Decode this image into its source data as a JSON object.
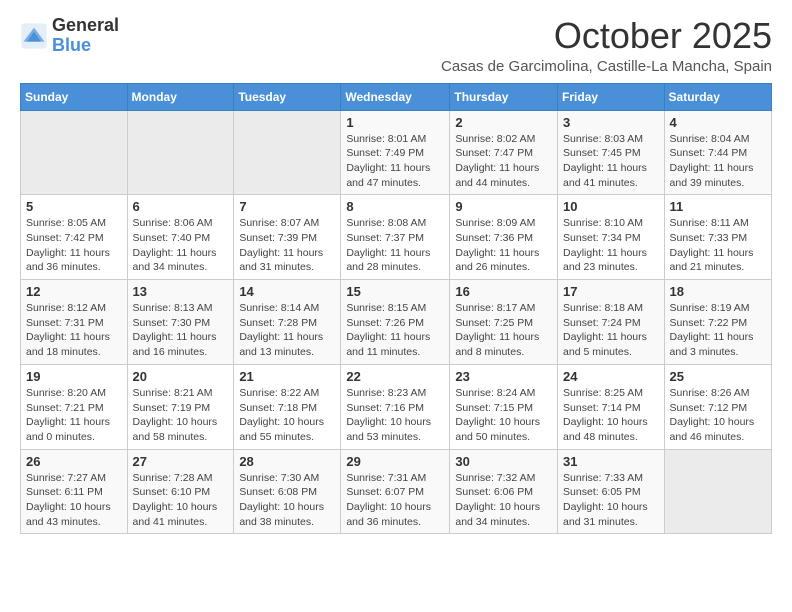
{
  "logo": {
    "general": "General",
    "blue": "Blue"
  },
  "header": {
    "month": "October 2025",
    "location": "Casas de Garcimolina, Castille-La Mancha, Spain"
  },
  "weekdays": [
    "Sunday",
    "Monday",
    "Tuesday",
    "Wednesday",
    "Thursday",
    "Friday",
    "Saturday"
  ],
  "weeks": [
    [
      {
        "day": "",
        "sunrise": "",
        "sunset": "",
        "daylight": ""
      },
      {
        "day": "",
        "sunrise": "",
        "sunset": "",
        "daylight": ""
      },
      {
        "day": "",
        "sunrise": "",
        "sunset": "",
        "daylight": ""
      },
      {
        "day": "1",
        "sunrise": "Sunrise: 8:01 AM",
        "sunset": "Sunset: 7:49 PM",
        "daylight": "Daylight: 11 hours and 47 minutes."
      },
      {
        "day": "2",
        "sunrise": "Sunrise: 8:02 AM",
        "sunset": "Sunset: 7:47 PM",
        "daylight": "Daylight: 11 hours and 44 minutes."
      },
      {
        "day": "3",
        "sunrise": "Sunrise: 8:03 AM",
        "sunset": "Sunset: 7:45 PM",
        "daylight": "Daylight: 11 hours and 41 minutes."
      },
      {
        "day": "4",
        "sunrise": "Sunrise: 8:04 AM",
        "sunset": "Sunset: 7:44 PM",
        "daylight": "Daylight: 11 hours and 39 minutes."
      }
    ],
    [
      {
        "day": "5",
        "sunrise": "Sunrise: 8:05 AM",
        "sunset": "Sunset: 7:42 PM",
        "daylight": "Daylight: 11 hours and 36 minutes."
      },
      {
        "day": "6",
        "sunrise": "Sunrise: 8:06 AM",
        "sunset": "Sunset: 7:40 PM",
        "daylight": "Daylight: 11 hours and 34 minutes."
      },
      {
        "day": "7",
        "sunrise": "Sunrise: 8:07 AM",
        "sunset": "Sunset: 7:39 PM",
        "daylight": "Daylight: 11 hours and 31 minutes."
      },
      {
        "day": "8",
        "sunrise": "Sunrise: 8:08 AM",
        "sunset": "Sunset: 7:37 PM",
        "daylight": "Daylight: 11 hours and 28 minutes."
      },
      {
        "day": "9",
        "sunrise": "Sunrise: 8:09 AM",
        "sunset": "Sunset: 7:36 PM",
        "daylight": "Daylight: 11 hours and 26 minutes."
      },
      {
        "day": "10",
        "sunrise": "Sunrise: 8:10 AM",
        "sunset": "Sunset: 7:34 PM",
        "daylight": "Daylight: 11 hours and 23 minutes."
      },
      {
        "day": "11",
        "sunrise": "Sunrise: 8:11 AM",
        "sunset": "Sunset: 7:33 PM",
        "daylight": "Daylight: 11 hours and 21 minutes."
      }
    ],
    [
      {
        "day": "12",
        "sunrise": "Sunrise: 8:12 AM",
        "sunset": "Sunset: 7:31 PM",
        "daylight": "Daylight: 11 hours and 18 minutes."
      },
      {
        "day": "13",
        "sunrise": "Sunrise: 8:13 AM",
        "sunset": "Sunset: 7:30 PM",
        "daylight": "Daylight: 11 hours and 16 minutes."
      },
      {
        "day": "14",
        "sunrise": "Sunrise: 8:14 AM",
        "sunset": "Sunset: 7:28 PM",
        "daylight": "Daylight: 11 hours and 13 minutes."
      },
      {
        "day": "15",
        "sunrise": "Sunrise: 8:15 AM",
        "sunset": "Sunset: 7:26 PM",
        "daylight": "Daylight: 11 hours and 11 minutes."
      },
      {
        "day": "16",
        "sunrise": "Sunrise: 8:17 AM",
        "sunset": "Sunset: 7:25 PM",
        "daylight": "Daylight: 11 hours and 8 minutes."
      },
      {
        "day": "17",
        "sunrise": "Sunrise: 8:18 AM",
        "sunset": "Sunset: 7:24 PM",
        "daylight": "Daylight: 11 hours and 5 minutes."
      },
      {
        "day": "18",
        "sunrise": "Sunrise: 8:19 AM",
        "sunset": "Sunset: 7:22 PM",
        "daylight": "Daylight: 11 hours and 3 minutes."
      }
    ],
    [
      {
        "day": "19",
        "sunrise": "Sunrise: 8:20 AM",
        "sunset": "Sunset: 7:21 PM",
        "daylight": "Daylight: 11 hours and 0 minutes."
      },
      {
        "day": "20",
        "sunrise": "Sunrise: 8:21 AM",
        "sunset": "Sunset: 7:19 PM",
        "daylight": "Daylight: 10 hours and 58 minutes."
      },
      {
        "day": "21",
        "sunrise": "Sunrise: 8:22 AM",
        "sunset": "Sunset: 7:18 PM",
        "daylight": "Daylight: 10 hours and 55 minutes."
      },
      {
        "day": "22",
        "sunrise": "Sunrise: 8:23 AM",
        "sunset": "Sunset: 7:16 PM",
        "daylight": "Daylight: 10 hours and 53 minutes."
      },
      {
        "day": "23",
        "sunrise": "Sunrise: 8:24 AM",
        "sunset": "Sunset: 7:15 PM",
        "daylight": "Daylight: 10 hours and 50 minutes."
      },
      {
        "day": "24",
        "sunrise": "Sunrise: 8:25 AM",
        "sunset": "Sunset: 7:14 PM",
        "daylight": "Daylight: 10 hours and 48 minutes."
      },
      {
        "day": "25",
        "sunrise": "Sunrise: 8:26 AM",
        "sunset": "Sunset: 7:12 PM",
        "daylight": "Daylight: 10 hours and 46 minutes."
      }
    ],
    [
      {
        "day": "26",
        "sunrise": "Sunrise: 7:27 AM",
        "sunset": "Sunset: 6:11 PM",
        "daylight": "Daylight: 10 hours and 43 minutes."
      },
      {
        "day": "27",
        "sunrise": "Sunrise: 7:28 AM",
        "sunset": "Sunset: 6:10 PM",
        "daylight": "Daylight: 10 hours and 41 minutes."
      },
      {
        "day": "28",
        "sunrise": "Sunrise: 7:30 AM",
        "sunset": "Sunset: 6:08 PM",
        "daylight": "Daylight: 10 hours and 38 minutes."
      },
      {
        "day": "29",
        "sunrise": "Sunrise: 7:31 AM",
        "sunset": "Sunset: 6:07 PM",
        "daylight": "Daylight: 10 hours and 36 minutes."
      },
      {
        "day": "30",
        "sunrise": "Sunrise: 7:32 AM",
        "sunset": "Sunset: 6:06 PM",
        "daylight": "Daylight: 10 hours and 34 minutes."
      },
      {
        "day": "31",
        "sunrise": "Sunrise: 7:33 AM",
        "sunset": "Sunset: 6:05 PM",
        "daylight": "Daylight: 10 hours and 31 minutes."
      },
      {
        "day": "",
        "sunrise": "",
        "sunset": "",
        "daylight": ""
      }
    ]
  ]
}
